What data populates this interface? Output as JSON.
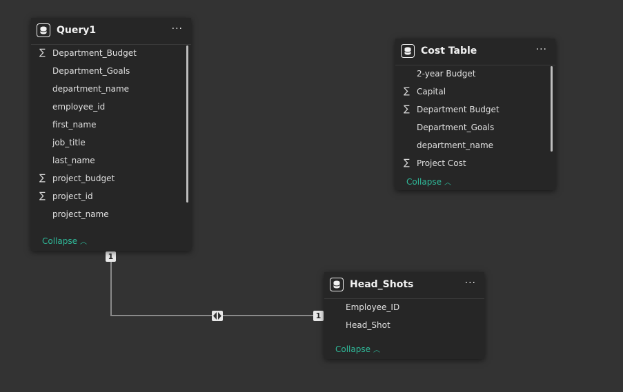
{
  "tables": {
    "query1": {
      "title": "Query1",
      "fields": [
        {
          "name": "Department_Budget",
          "sigma": true
        },
        {
          "name": "Department_Goals",
          "sigma": false
        },
        {
          "name": "department_name",
          "sigma": false
        },
        {
          "name": "employee_id",
          "sigma": false
        },
        {
          "name": "first_name",
          "sigma": false
        },
        {
          "name": "job_title",
          "sigma": false
        },
        {
          "name": "last_name",
          "sigma": false
        },
        {
          "name": "project_budget",
          "sigma": true
        },
        {
          "name": "project_id",
          "sigma": true
        },
        {
          "name": "project_name",
          "sigma": false
        }
      ],
      "collapse_label": "Collapse"
    },
    "cost_table": {
      "title": "Cost Table",
      "fields": [
        {
          "name": "2-year Budget",
          "sigma": false
        },
        {
          "name": "Capital",
          "sigma": true
        },
        {
          "name": "Department Budget",
          "sigma": true
        },
        {
          "name": "Department_Goals",
          "sigma": false
        },
        {
          "name": "department_name",
          "sigma": false
        },
        {
          "name": "Project Cost",
          "sigma": true
        }
      ],
      "collapse_label": "Collapse"
    },
    "head_shots": {
      "title": "Head_Shots",
      "fields": [
        {
          "name": "Employee_ID",
          "sigma": false
        },
        {
          "name": "Head_Shot",
          "sigma": false
        }
      ],
      "collapse_label": "Collapse"
    }
  },
  "relationship": {
    "from_cardinality": "1",
    "to_cardinality": "1",
    "direction_icon": "bidirectional-filter-icon"
  },
  "symbols": {
    "sigma": "∑",
    "more": "···",
    "chevron_up": "︿"
  },
  "colors": {
    "canvas": "#333333",
    "card": "#262626",
    "accent": "#2fb999",
    "line": "#8a8a8a"
  }
}
